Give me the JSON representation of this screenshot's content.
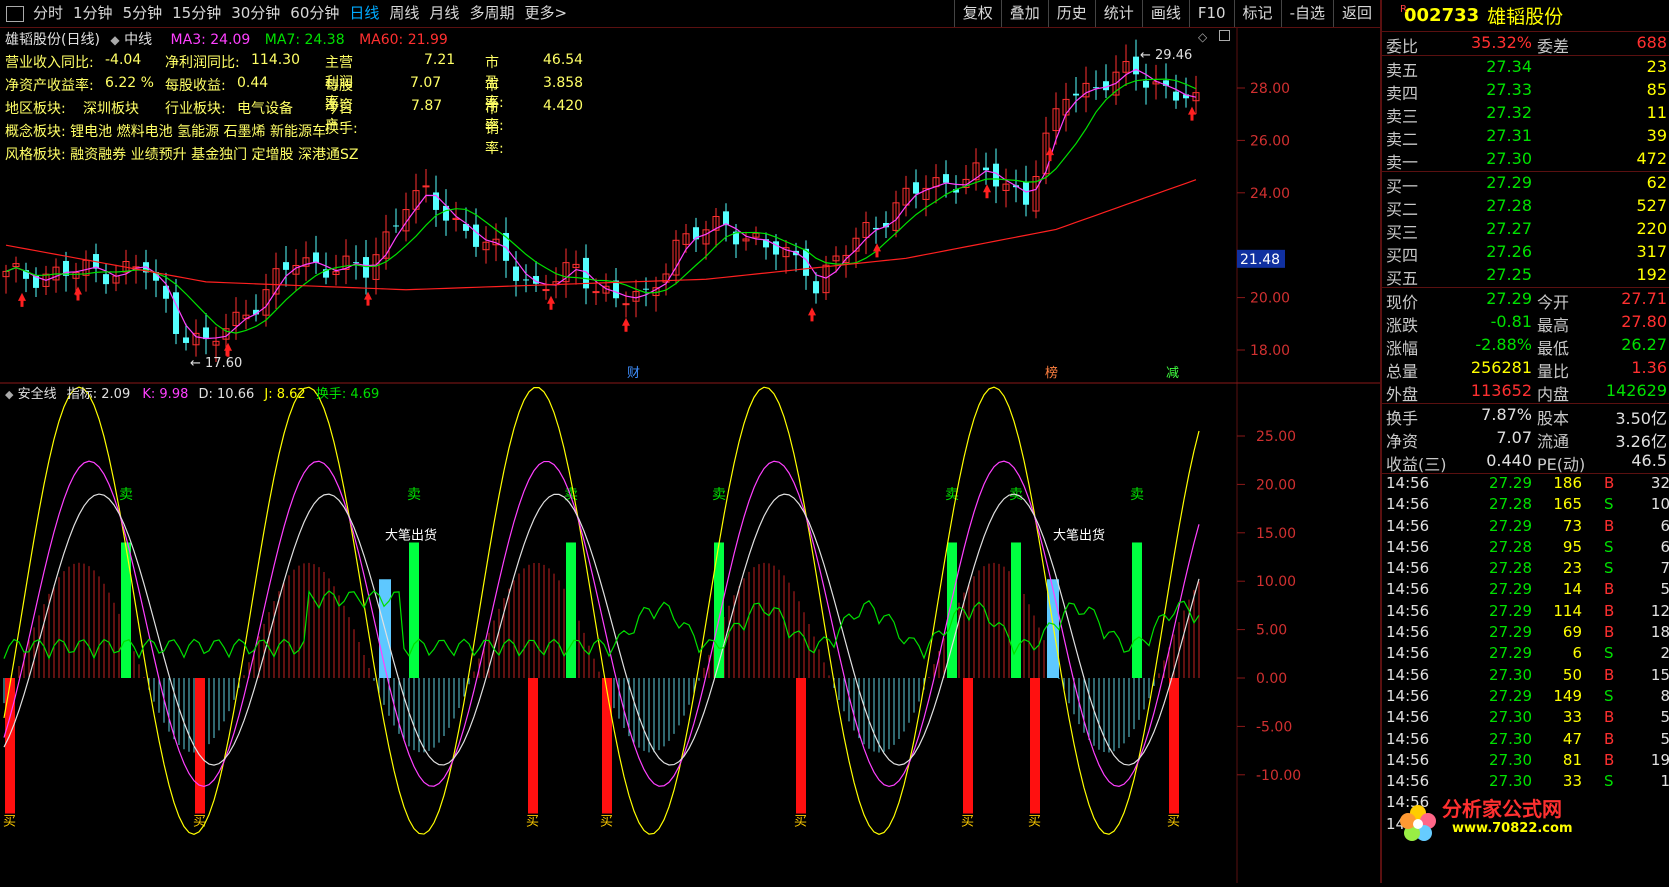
{
  "toolbar": {
    "left_items": [
      "分时",
      "1分钟",
      "5分钟",
      "15分钟",
      "30分钟",
      "60分钟",
      "日线",
      "周线",
      "月线",
      "多周期",
      "更多"
    ],
    "active": "日线",
    "more_arrow": ">",
    "right_items": [
      "复权",
      "叠加",
      "历史",
      "统计",
      "画线",
      "F10",
      "标记",
      "-自选",
      "返回"
    ]
  },
  "main_chart": {
    "title": "雄韬股份(日线)",
    "period": "中线",
    "ma_labels": [
      {
        "text": "MA3: 24.09",
        "color": "#ff40ff"
      },
      {
        "text": "MA7: 24.38",
        "color": "#00e000"
      },
      {
        "text": "MA60: 21.99",
        "color": "#ff3030"
      }
    ],
    "info": [
      [
        "营业收入同比:",
        "-4.04",
        "净利润同比:",
        "114.30",
        "主营利润率:",
        "7.21",
        "市盈率:",
        "46.54"
      ],
      [
        "净资产收益率:",
        "6.22 %",
        "每股收益:",
        "0.44",
        "每股净资产:",
        "7.07",
        "市净率:",
        "3.858"
      ],
      [
        "地区板块:",
        "深圳板块",
        "行业板块:",
        "电气设备",
        "今日换手:",
        "7.87",
        "市销率:",
        "4.420"
      ]
    ],
    "concept": "概念板块: 锂电池 燃料电池 氢能源 石墨烯 新能源车",
    "style": "风格板块: 融资融券 业绩预升 基金独门 定增股 深港通SZ",
    "high_label": "29.46",
    "low_label": "17.60",
    "price_ticks": [
      "28.00",
      "26.00",
      "24.00",
      "20.00",
      "18.00"
    ],
    "current_tag": "21.48",
    "event_labels": [
      "财",
      "榜",
      "减"
    ]
  },
  "indicator": {
    "name": "安全线",
    "items": [
      {
        "text": "指标: 2.09",
        "color": "#e0e0e0"
      },
      {
        "text": "K: 9.98",
        "color": "#ff40ff"
      },
      {
        "text": "D: 10.66",
        "color": "#e0e0e0"
      },
      {
        "text": "J: 8.62",
        "color": "#ffff00"
      },
      {
        "text": "换手: 4.69",
        "color": "#00e000"
      }
    ],
    "ticks": [
      "25.00",
      "20.00",
      "15.00",
      "10.00",
      "5.00",
      "0.00",
      "-5.00",
      "-10.00"
    ],
    "sell_label": "卖",
    "buy_label": "买",
    "big_out_label": "大笔出货"
  },
  "quote": {
    "flag": "R",
    "code": "002733",
    "name": "雄韬股份",
    "wei_bi_label": "委比",
    "wei_bi": "35.32%",
    "wei_cha_label": "委差",
    "wei_cha": "688",
    "sells": [
      {
        "label": "卖五",
        "price": "27.34",
        "vol": "23"
      },
      {
        "label": "卖四",
        "price": "27.33",
        "vol": "85"
      },
      {
        "label": "卖三",
        "price": "27.32",
        "vol": "11"
      },
      {
        "label": "卖二",
        "price": "27.31",
        "vol": "39"
      },
      {
        "label": "卖一",
        "price": "27.30",
        "vol": "472"
      }
    ],
    "buys": [
      {
        "label": "买一",
        "price": "27.29",
        "vol": "62"
      },
      {
        "label": "买二",
        "price": "27.28",
        "vol": "527"
      },
      {
        "label": "买三",
        "price": "27.27",
        "vol": "220"
      },
      {
        "label": "买四",
        "price": "27.26",
        "vol": "317"
      },
      {
        "label": "买五",
        "price": "27.25",
        "vol": "192"
      }
    ],
    "stats": [
      {
        "l1": "现价",
        "v1": "27.29",
        "c1": "c-g",
        "l2": "今开",
        "v2": "27.71",
        "c2": "c-r"
      },
      {
        "l1": "涨跌",
        "v1": "-0.81",
        "c1": "c-g",
        "l2": "最高",
        "v2": "27.80",
        "c2": "c-r"
      },
      {
        "l1": "涨幅",
        "v1": "-2.88%",
        "c1": "c-g",
        "l2": "最低",
        "v2": "26.27",
        "c2": "c-g"
      },
      {
        "l1": "总量",
        "v1": "256281",
        "c1": "c-y",
        "l2": "量比",
        "v2": "1.36",
        "c2": "c-r"
      },
      {
        "l1": "外盘",
        "v1": "113652",
        "c1": "c-r",
        "l2": "内盘",
        "v2": "142629",
        "c2": "c-g"
      }
    ],
    "stats2": [
      {
        "l1": "换手",
        "v1": "7.87%",
        "l2": "股本",
        "v2": "3.50亿"
      },
      {
        "l1": "净资",
        "v1": "7.07",
        "l2": "流通",
        "v2": "3.26亿"
      },
      {
        "l1": "收益(三)",
        "v1": "0.440",
        "l2": "PE(动)",
        "v2": "46.5"
      }
    ],
    "ticks": [
      {
        "t": "14:56",
        "p": "27.29",
        "pc": "c-g",
        "v": "186",
        "d": "B",
        "n": "32"
      },
      {
        "t": "14:56",
        "p": "27.28",
        "pc": "c-g",
        "v": "165",
        "d": "S",
        "n": "10"
      },
      {
        "t": "14:56",
        "p": "27.29",
        "pc": "c-g",
        "v": "73",
        "d": "B",
        "n": "6"
      },
      {
        "t": "14:56",
        "p": "27.28",
        "pc": "c-g",
        "v": "95",
        "d": "S",
        "n": "6"
      },
      {
        "t": "14:56",
        "p": "27.28",
        "pc": "c-g",
        "v": "23",
        "d": "S",
        "n": "7"
      },
      {
        "t": "14:56",
        "p": "27.29",
        "pc": "c-g",
        "v": "14",
        "d": "B",
        "n": "5"
      },
      {
        "t": "14:56",
        "p": "27.29",
        "pc": "c-g",
        "v": "114",
        "d": "B",
        "n": "12"
      },
      {
        "t": "14:56",
        "p": "27.29",
        "pc": "c-g",
        "v": "69",
        "d": "B",
        "n": "18"
      },
      {
        "t": "14:56",
        "p": "27.29",
        "pc": "c-g",
        "v": "6",
        "d": "S",
        "n": "2"
      },
      {
        "t": "14:56",
        "p": "27.30",
        "pc": "c-g",
        "v": "50",
        "d": "B",
        "n": "15"
      },
      {
        "t": "14:56",
        "p": "27.29",
        "pc": "c-g",
        "v": "149",
        "d": "S",
        "n": "8"
      },
      {
        "t": "14:56",
        "p": "27.30",
        "pc": "c-g",
        "v": "33",
        "d": "B",
        "n": "5"
      },
      {
        "t": "14:56",
        "p": "27.30",
        "pc": "c-g",
        "v": "47",
        "d": "B",
        "n": "5"
      },
      {
        "t": "14:56",
        "p": "27.30",
        "pc": "c-g",
        "v": "81",
        "d": "B",
        "n": "19"
      },
      {
        "t": "14:56",
        "p": "27.30",
        "pc": "c-g",
        "v": "33",
        "d": "S",
        "n": "1"
      },
      {
        "t": "14:56",
        "p": "",
        "pc": "c-g",
        "v": "",
        "d": "",
        "n": ""
      },
      {
        "t": "14:56",
        "p": "",
        "pc": "c-g",
        "v": "",
        "d": "",
        "n": ""
      }
    ]
  },
  "watermark": {
    "name": "分析家公式网",
    "url": "www.70822.com"
  },
  "colors": {
    "up": "#ff3030",
    "down": "#54ffff",
    "ma3": "#ff40ff",
    "ma7": "#00e000",
    "ma60": "#ff2020",
    "grid": "#5a1010"
  }
}
